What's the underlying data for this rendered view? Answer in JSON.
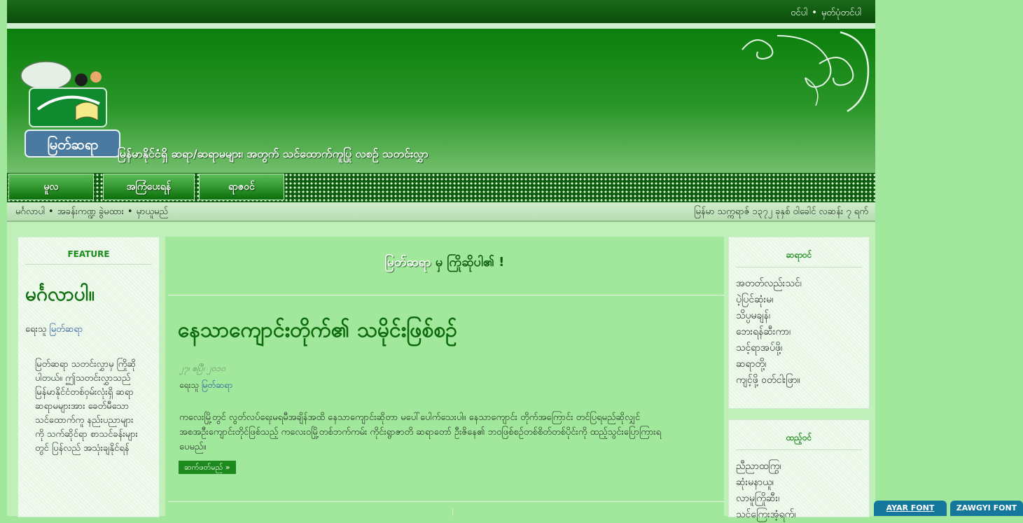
{
  "topbar": {
    "login": "ဝင်ပါ",
    "separator": "•",
    "register": "မှတ်ပုံတင်ပါ"
  },
  "header": {
    "logo_text": "မြတ်ဆရာ",
    "tagline": "မြန်မာနိုင်ငံရှိ ဆရာ/ဆရာမများ၊ အတွက် သင်ထောက်ကူပြု လစဉ် သတင်းလွှာ"
  },
  "nav": {
    "items": [
      {
        "label": "မူလ"
      },
      {
        "label": "အကြံပေးရန်"
      },
      {
        "label": "ရာဇဝင်"
      }
    ]
  },
  "subbar": {
    "left": [
      "မင်္ဂလာပါ",
      "အခန်းကဏ္ဍ ခွဲမထား",
      "မှာယူမည်"
    ],
    "bullet": "•",
    "date": "မြန်မာ သက္ကရာဇ် ၁၃၇၂ ခုနှစ် ဝါခေါင် လဆန်း ၇ ရက်"
  },
  "left_sidebar": {
    "heading": "FEATURE",
    "title": "မင်္ဂလာပါ။",
    "byline_prefix": "ရေးသူ",
    "byline_author": "မြတ်ဆရာ",
    "blurb": "မြတ်ဆရာ သတင်းလွှာမှ ကြိုဆိုပါတယ်။ ဤသတင်းလွှာသည် မြန်မာနိုင်ငံတစ်ဝှမ်းလုံးရှိ ဆရာဆရာမများအား ခေတ်မီသော သင်ထောက်ကူ နည်းပညာများကို သက်ဆိုင်ရာ စာသင်ခန်းများတွင် ပြန်လည် အသုံးချနိုင်ရန်"
  },
  "main": {
    "welcome_brand": "မြတ်ဆရာ",
    "welcome_rest": " မှ ကြိုဆိုပါ၏ !",
    "post": {
      "title": "နေသာကျောင်းတိုက်၏ သမိုင်းဖြစ်စဉ်",
      "date": "၂၇၊ ဧပြီ၊ ၂၀၁၀",
      "byline_prefix": "ရေးသူ",
      "byline_author": "မြတ်ဆရာ",
      "body": "ကလေးမြို့တွင် လွတ်လပ်ရေးမရမီအချိန်အထိ နေသာကျောင်းဆိုတာ မပေါ်ပေါက်သေးပါ။ နေသာကျောင်း တိုက်အကြောင်း တင်ပြရမည်ဆိုလျှင် အစအဦးကျောင်းတိုင်ဖြစ်သည့် ကလေးဝမြို့တစ်ဘက်ကမ်း ကိုင်းရွာဇာတိ ဆရာတော် ဦးဇိနေ၏ ဘဝဖြစ်စဉ်တစ်စိတ်တစ်ပိုင်းကို ထည့်သွင်းပြောကြားရပေမည်။",
      "readmore": "ဆက်ဖတ်မည် »"
    }
  },
  "right_sidebar": {
    "box1": {
      "heading": "ဆရာဝင်",
      "items": [
        "အတတ်လည်းသင်၊",
        "ပဲ့ပြင်ဆုံးမ၊",
        "သိပ္ပမချန်၊",
        "ဘေးရန်ဆီးကာ၊",
        "သင့်ရာအပ်ဖို့၊",
        "ဆရာတို့၊",
        "ကျင့်ဖို့ ဝတ်ငါးဖြာ။"
      ]
    },
    "box2": {
      "heading": "ထည့်ဝင်",
      "items": [
        "ညီညာထကြွ၊",
        "ဆုံးမနာယူ၊",
        "လာမူကြိုဆီး၊",
        "သင်ကြေးအံ့ရက်၊"
      ]
    }
  },
  "font_buttons": {
    "ayar": "AYAR FONT",
    "zawgyi": "ZAWGYI FONT"
  },
  "colors": {
    "page_bg": "#a2e89c",
    "header_green": "#0b7f0b",
    "nav_dark": "#0c5a0c",
    "link_blue": "#1a4d9a",
    "font_btn": "#14779b"
  }
}
